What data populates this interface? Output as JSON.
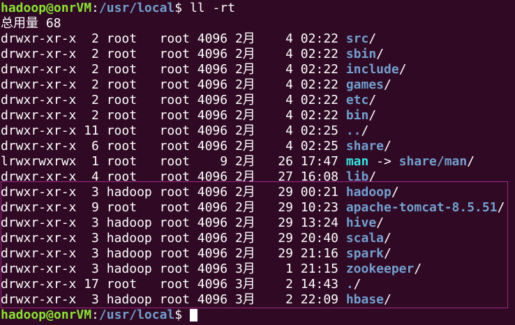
{
  "prompt": {
    "user_host": "hadoop@onrVM",
    "colon": ":",
    "cwd": "/usr/local",
    "dollar": "$ "
  },
  "command": "ll -rt",
  "total_line": "总用量 68",
  "listing": [
    {
      "perm": "drwxr-xr-x",
      "links": "2",
      "owner": "root",
      "group": "root",
      "size": "4096",
      "month": "2月",
      "day": "4",
      "time": "02:22",
      "name": "src",
      "suffix": "/",
      "kind": "dir"
    },
    {
      "perm": "drwxr-xr-x",
      "links": "2",
      "owner": "root",
      "group": "root",
      "size": "4096",
      "month": "2月",
      "day": "4",
      "time": "02:22",
      "name": "sbin",
      "suffix": "/",
      "kind": "dir"
    },
    {
      "perm": "drwxr-xr-x",
      "links": "2",
      "owner": "root",
      "group": "root",
      "size": "4096",
      "month": "2月",
      "day": "4",
      "time": "02:22",
      "name": "include",
      "suffix": "/",
      "kind": "dir"
    },
    {
      "perm": "drwxr-xr-x",
      "links": "2",
      "owner": "root",
      "group": "root",
      "size": "4096",
      "month": "2月",
      "day": "4",
      "time": "02:22",
      "name": "games",
      "suffix": "/",
      "kind": "dir"
    },
    {
      "perm": "drwxr-xr-x",
      "links": "2",
      "owner": "root",
      "group": "root",
      "size": "4096",
      "month": "2月",
      "day": "4",
      "time": "02:22",
      "name": "etc",
      "suffix": "/",
      "kind": "dir"
    },
    {
      "perm": "drwxr-xr-x",
      "links": "2",
      "owner": "root",
      "group": "root",
      "size": "4096",
      "month": "2月",
      "day": "4",
      "time": "02:22",
      "name": "bin",
      "suffix": "/",
      "kind": "dir"
    },
    {
      "perm": "drwxr-xr-x",
      "links": "11",
      "owner": "root",
      "group": "root",
      "size": "4096",
      "month": "2月",
      "day": "4",
      "time": "02:25",
      "name": "..",
      "suffix": "/",
      "kind": "dir"
    },
    {
      "perm": "drwxr-xr-x",
      "links": "6",
      "owner": "root",
      "group": "root",
      "size": "4096",
      "month": "2月",
      "day": "4",
      "time": "02:25",
      "name": "share",
      "suffix": "/",
      "kind": "dir"
    },
    {
      "perm": "lrwxrwxrwx",
      "links": "1",
      "owner": "root",
      "group": "root",
      "size": "9",
      "month": "2月",
      "day": "26",
      "time": "17:47",
      "name": "man",
      "arrow": " -> ",
      "target": "share/man",
      "suffix": "/",
      "kind": "link"
    },
    {
      "perm": "drwxr-xr-x",
      "links": "4",
      "owner": "root",
      "group": "root",
      "size": "4096",
      "month": "2月",
      "day": "27",
      "time": "16:08",
      "name": "lib",
      "suffix": "/",
      "kind": "dir"
    },
    {
      "perm": "drwxr-xr-x",
      "links": "3",
      "owner": "hadoop",
      "group": "root",
      "size": "4096",
      "month": "2月",
      "day": "29",
      "time": "00:21",
      "name": "hadoop",
      "suffix": "/",
      "kind": "dir"
    },
    {
      "perm": "drwxr-xr-x",
      "links": "9",
      "owner": "root",
      "group": "root",
      "size": "4096",
      "month": "2月",
      "day": "29",
      "time": "10:23",
      "name": "apache-tomcat-8.5.51",
      "suffix": "/",
      "kind": "dir"
    },
    {
      "perm": "drwxr-xr-x",
      "links": "3",
      "owner": "hadoop",
      "group": "root",
      "size": "4096",
      "month": "2月",
      "day": "29",
      "time": "13:24",
      "name": "hive",
      "suffix": "/",
      "kind": "dir"
    },
    {
      "perm": "drwxr-xr-x",
      "links": "3",
      "owner": "hadoop",
      "group": "root",
      "size": "4096",
      "month": "2月",
      "day": "29",
      "time": "20:40",
      "name": "scala",
      "suffix": "/",
      "kind": "dir"
    },
    {
      "perm": "drwxr-xr-x",
      "links": "3",
      "owner": "hadoop",
      "group": "root",
      "size": "4096",
      "month": "2月",
      "day": "29",
      "time": "21:16",
      "name": "spark",
      "suffix": "/",
      "kind": "dir"
    },
    {
      "perm": "drwxr-xr-x",
      "links": "3",
      "owner": "hadoop",
      "group": "root",
      "size": "4096",
      "month": "3月",
      "day": "1",
      "time": "21:15",
      "name": "zookeeper",
      "suffix": "/",
      "kind": "dir"
    },
    {
      "perm": "drwxr-xr-x",
      "links": "17",
      "owner": "root",
      "group": "root",
      "size": "4096",
      "month": "3月",
      "day": "2",
      "time": "14:43",
      "name": ".",
      "suffix": "/",
      "kind": "dir"
    },
    {
      "perm": "drwxr-xr-x",
      "links": "3",
      "owner": "hadoop",
      "group": "root",
      "size": "4096",
      "month": "3月",
      "day": "2",
      "time": "22:09",
      "name": "hbase",
      "suffix": "/",
      "kind": "dir"
    }
  ],
  "colors": {
    "background": "#300a24",
    "prompt_user": "#8ae234",
    "prompt_path": "#729fcf",
    "directory": "#729fcf",
    "symlink": "#34e2e2",
    "highlight_border": "#a0288a"
  }
}
